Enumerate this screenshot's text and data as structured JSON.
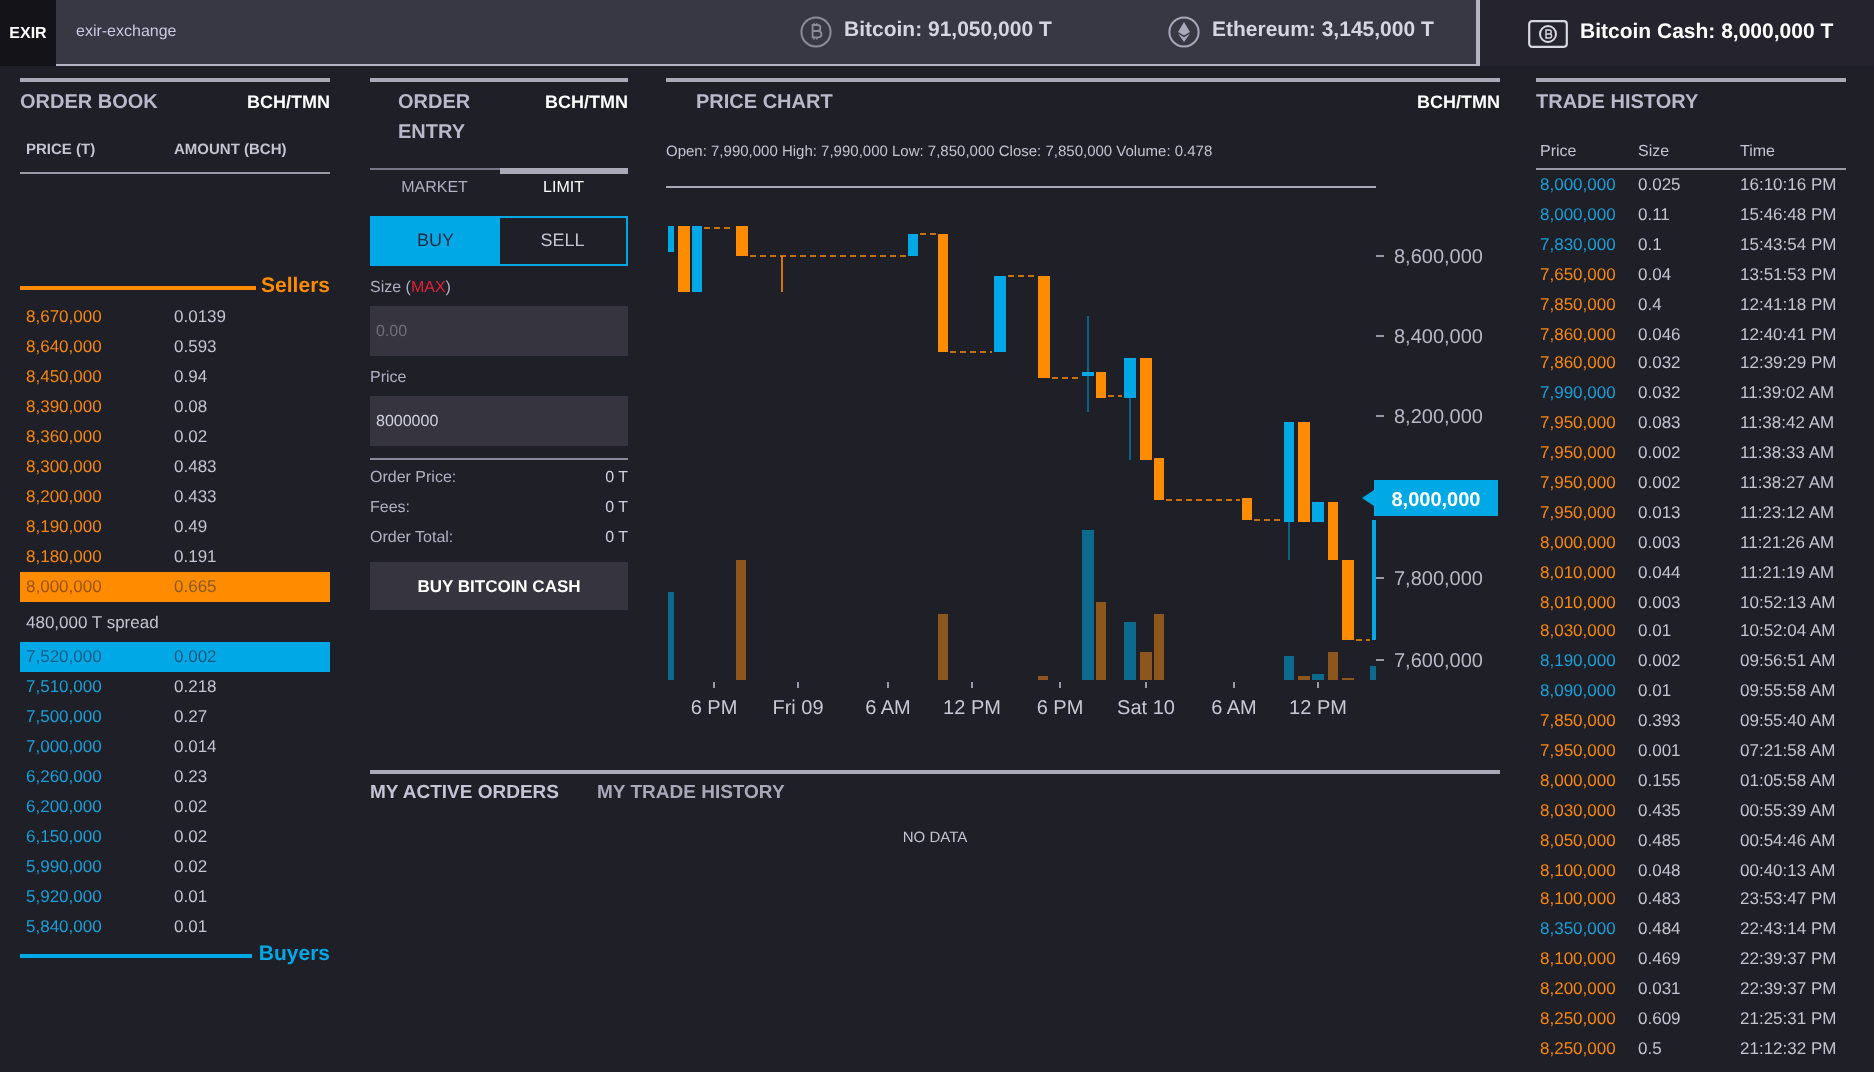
{
  "top_bar": {
    "logo": "EXIR",
    "exchange_name": "exir-exchange",
    "tickers": [
      {
        "kind": "bitcoin",
        "label": "Bitcoin: 91,050,000 T",
        "selected": false
      },
      {
        "kind": "ethereum",
        "label": "Ethereum: 3,145,000 T",
        "selected": false
      },
      {
        "kind": "bitcoin-cash",
        "label": "Bitcoin Cash: 8,000,000 T",
        "selected": true
      }
    ]
  },
  "order_book": {
    "title": "ORDER BOOK",
    "pair": "BCH/TMN",
    "columns": [
      "PRICE (T)",
      "AMOUNT (BCH)"
    ],
    "sellers_label": "Sellers",
    "sellers": [
      {
        "price": "8,670,000",
        "amount": "0.0139",
        "selected": false
      },
      {
        "price": "8,640,000",
        "amount": "0.593",
        "selected": false
      },
      {
        "price": "8,450,000",
        "amount": "0.94",
        "selected": false
      },
      {
        "price": "8,390,000",
        "amount": "0.08",
        "selected": false
      },
      {
        "price": "8,360,000",
        "amount": "0.02",
        "selected": false
      },
      {
        "price": "8,300,000",
        "amount": "0.483",
        "selected": false
      },
      {
        "price": "8,200,000",
        "amount": "0.433",
        "selected": false
      },
      {
        "price": "8,190,000",
        "amount": "0.49",
        "selected": false
      },
      {
        "price": "8,180,000",
        "amount": "0.191",
        "selected": false
      },
      {
        "price": "8,000,000",
        "amount": "0.665",
        "selected": true
      }
    ],
    "spread": "480,000 T spread",
    "buyers": [
      {
        "price": "7,520,000",
        "amount": "0.002",
        "selected": true
      },
      {
        "price": "7,510,000",
        "amount": "0.218",
        "selected": false
      },
      {
        "price": "7,500,000",
        "amount": "0.27",
        "selected": false
      },
      {
        "price": "7,000,000",
        "amount": "0.014",
        "selected": false
      },
      {
        "price": "6,260,000",
        "amount": "0.23",
        "selected": false
      },
      {
        "price": "6,200,000",
        "amount": "0.02",
        "selected": false
      },
      {
        "price": "6,150,000",
        "amount": "0.02",
        "selected": false
      },
      {
        "price": "5,990,000",
        "amount": "0.02",
        "selected": false
      },
      {
        "price": "5,920,000",
        "amount": "0.01",
        "selected": false
      },
      {
        "price": "5,840,000",
        "amount": "0.01",
        "selected": false
      }
    ],
    "buyers_label": "Buyers"
  },
  "order_entry": {
    "title": "ORDER ENTRY",
    "pair": "BCH/TMN",
    "tabs": [
      {
        "label": "MARKET",
        "selected": false
      },
      {
        "label": "LIMIT",
        "selected": true
      }
    ],
    "sides": [
      {
        "label": "BUY",
        "selected": true
      },
      {
        "label": "SELL",
        "selected": false
      }
    ],
    "size": {
      "label_prefix": "Size (",
      "max": "MAX",
      "label_suffix": ")",
      "placeholder": "0.00"
    },
    "price": {
      "label": "Price",
      "value": "8000000"
    },
    "summary": [
      {
        "label": "Order Price:",
        "value": "0 T"
      },
      {
        "label": "Fees:",
        "value": "0 T"
      },
      {
        "label": "Order Total:",
        "value": "0 T"
      }
    ],
    "submit": "BUY BITCOIN CASH"
  },
  "price_chart": {
    "title": "PRICE CHART",
    "pair": "BCH/TMN",
    "ohlc": "Open: 7,990,000 High: 7,990,000 Low: 7,850,000 Close: 7,850,000 Volume: 0.478",
    "y_labels": [
      "8,600,000",
      "8,400,000",
      "8,200,000",
      "7,800,000",
      "7,600,000"
    ],
    "x_labels": [
      "6 PM",
      "Fri 09",
      "6 AM",
      "12 PM",
      "6 PM",
      "Sat 10",
      "6 AM",
      "12 PM"
    ],
    "last_price": "8,000,000"
  },
  "my_orders": {
    "tabs": [
      {
        "label": "MY ACTIVE ORDERS",
        "selected": true
      },
      {
        "label": "MY TRADE HISTORY",
        "selected": false
      }
    ],
    "empty_text": "NO DATA"
  },
  "trade_history": {
    "title": "TRADE HISTORY",
    "columns": [
      "Price",
      "Size",
      "Time"
    ],
    "rows": [
      {
        "price": "8,000,000",
        "size": "0.025",
        "time": "16:10:16 PM",
        "color": "#1a9fd8"
      },
      {
        "price": "8,000,000",
        "size": "0.11",
        "time": "15:46:48 PM",
        "color": "#1a9fd8"
      },
      {
        "price": "7,830,000",
        "size": "0.1",
        "time": "15:43:54 PM",
        "color": "#1a9fd8"
      },
      {
        "price": "7,650,000",
        "size": "0.04",
        "time": "13:51:53 PM",
        "color": "#f7870f"
      },
      {
        "price": "7,850,000",
        "size": "0.4",
        "time": "12:41:18 PM",
        "color": "#f7870f"
      },
      {
        "price": "7,860,000",
        "size": "0.046",
        "time": "12:40:41 PM",
        "color": "#f7870f"
      },
      {
        "price": "7,860,000",
        "size": "0.032",
        "time": "12:39:29 PM",
        "color": "#f7870f"
      },
      {
        "price": "7,990,000",
        "size": "0.032",
        "time": "11:39:02 AM",
        "color": "#1a9fd8"
      },
      {
        "price": "7,950,000",
        "size": "0.083",
        "time": "11:38:42 AM",
        "color": "#f7870f"
      },
      {
        "price": "7,950,000",
        "size": "0.002",
        "time": "11:38:33 AM",
        "color": "#f7870f"
      },
      {
        "price": "7,950,000",
        "size": "0.002",
        "time": "11:38:27 AM",
        "color": "#f7870f"
      },
      {
        "price": "7,950,000",
        "size": "0.013",
        "time": "11:23:12 AM",
        "color": "#f7870f"
      },
      {
        "price": "8,000,000",
        "size": "0.003",
        "time": "11:21:26 AM",
        "color": "#f7870f"
      },
      {
        "price": "8,010,000",
        "size": "0.044",
        "time": "11:21:19 AM",
        "color": "#f7870f"
      },
      {
        "price": "8,010,000",
        "size": "0.003",
        "time": "10:52:13 AM",
        "color": "#f7870f"
      },
      {
        "price": "8,030,000",
        "size": "0.01",
        "time": "10:52:04 AM",
        "color": "#f7870f"
      },
      {
        "price": "8,190,000",
        "size": "0.002",
        "time": "09:56:51 AM",
        "color": "#1a9fd8"
      },
      {
        "price": "8,090,000",
        "size": "0.01",
        "time": "09:55:58 AM",
        "color": "#1a9fd8"
      },
      {
        "price": "7,850,000",
        "size": "0.393",
        "time": "09:55:40 AM",
        "color": "#f7870f"
      },
      {
        "price": "7,950,000",
        "size": "0.001",
        "time": "07:21:58 AM",
        "color": "#f7870f"
      },
      {
        "price": "8,000,000",
        "size": "0.155",
        "time": "01:05:58 AM",
        "color": "#f7870f"
      },
      {
        "price": "8,030,000",
        "size": "0.435",
        "time": "00:55:39 AM",
        "color": "#f7870f"
      },
      {
        "price": "8,050,000",
        "size": "0.485",
        "time": "00:54:46 AM",
        "color": "#f7870f"
      },
      {
        "price": "8,100,000",
        "size": "0.048",
        "time": "00:40:13 AM",
        "color": "#f7870f"
      },
      {
        "price": "8,100,000",
        "size": "0.483",
        "time": "23:53:47 PM",
        "color": "#f7870f"
      },
      {
        "price": "8,350,000",
        "size": "0.484",
        "time": "22:43:14 PM",
        "color": "#1a9fd8"
      },
      {
        "price": "8,100,000",
        "size": "0.469",
        "time": "22:39:37 PM",
        "color": "#f7870f"
      },
      {
        "price": "8,200,000",
        "size": "0.031",
        "time": "22:39:37 PM",
        "color": "#f7870f"
      },
      {
        "price": "8,250,000",
        "size": "0.609",
        "time": "21:25:31 PM",
        "color": "#f7870f"
      },
      {
        "price": "8,250,000",
        "size": "0.5",
        "time": "21:12:32 PM",
        "color": "#f7870f"
      }
    ]
  }
}
